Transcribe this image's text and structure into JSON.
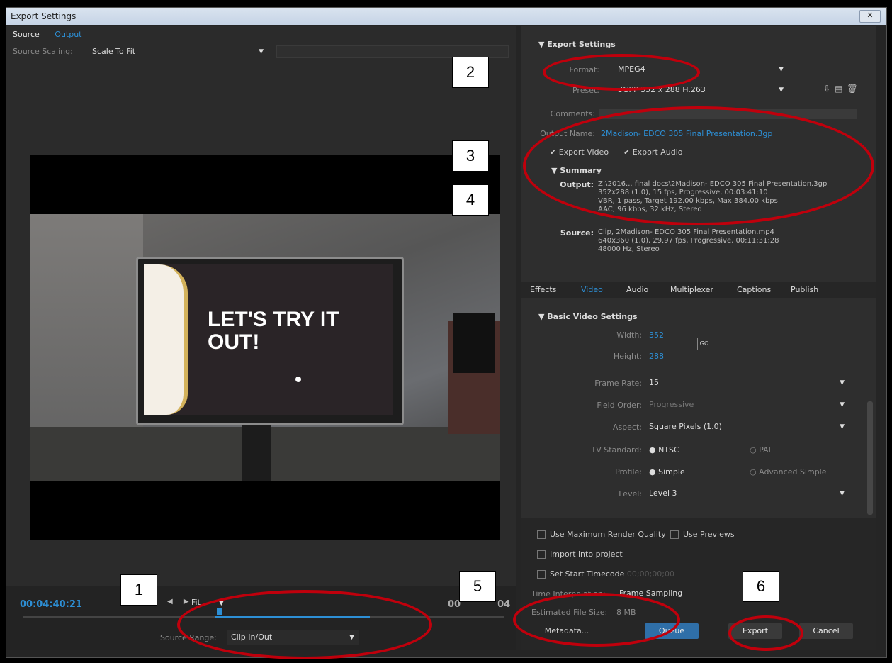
{
  "window": {
    "title": "Export Settings",
    "close_label": "✕"
  },
  "left": {
    "tabs": [
      "Source",
      "Output"
    ],
    "source_scaling_label": "Source Scaling:",
    "source_scaling_value": "Scale To Fit",
    "screen_text_line1": "LET'S TRY IT",
    "screen_text_line2": "OUT!",
    "timecode_left": "00:04:40:21",
    "timecode_right": "00",
    "timecode_right_tail": "04",
    "fit_value": "Fit",
    "source_range_label": "Source Range:",
    "source_range_value": "Clip In/Out"
  },
  "export": {
    "header": "Export Settings",
    "format_label": "Format:",
    "format_value": "MPEG4",
    "preset_label": "Preset:",
    "preset_value": "3GPP 352 x 288 H.263",
    "comments_label": "Comments:",
    "output_name_label": "Output Name:",
    "output_name_value": "2Madison- EDCO 305 Final Presentation.3gp",
    "export_video_label": "Export Video",
    "export_audio_label": "Export Audio",
    "summary_header": "Summary",
    "output_summary_label": "Output:",
    "output_summary_lines": [
      "Z:\\2016... final docs\\2Madison- EDCO 305 Final Presentation.3gp",
      "352x288 (1.0), 15 fps, Progressive, 00:03:41:10",
      "VBR, 1 pass, Target 192.00 kbps, Max 384.00 kbps",
      "AAC, 96 kbps, 32 kHz, Stereo"
    ],
    "source_summary_label": "Source:",
    "source_summary_lines": [
      "Clip, 2Madison- EDCO 305 Final Presentation.mp4",
      "640x360 (1.0), 29.97 fps, Progressive, 00:11:31:28",
      "48000 Hz, Stereo"
    ]
  },
  "fx_tabs": [
    "Effects",
    "Video",
    "Audio",
    "Multiplexer",
    "Captions",
    "Publish"
  ],
  "basic_video": {
    "header": "Basic Video Settings",
    "width_label": "Width:",
    "width_value": "352",
    "height_label": "Height:",
    "height_value": "288",
    "frame_rate_label": "Frame Rate:",
    "frame_rate_value": "15",
    "field_order_label": "Field Order:",
    "field_order_value": "Progressive",
    "aspect_label": "Aspect:",
    "aspect_value": "Square Pixels (1.0)",
    "tv_standard_label": "TV Standard:",
    "tv_ntsc": "NTSC",
    "tv_pal": "PAL",
    "profile_label": "Profile:",
    "profile_simple": "Simple",
    "profile_advanced": "Advanced Simple",
    "level_label": "Level:",
    "level_value": "Level 3"
  },
  "bottom": {
    "max_render_label": "Use Maximum Render Quality",
    "use_previews_label": "Use Previews",
    "import_project_label": "Import into project",
    "start_timecode_label": "Set Start Timecode",
    "start_timecode_value": "00;00;00;00",
    "time_interp_label": "Time Interpolation:",
    "time_interp_value": "Frame Sampling",
    "file_size_label": "Estimated File Size:",
    "file_size_value": "8 MB",
    "metadata_label": "Metadata...",
    "queue_label": "Queue",
    "export_label": "Export",
    "cancel_label": "Cancel"
  },
  "annotations": [
    "1",
    "2",
    "3",
    "4",
    "5",
    "6"
  ],
  "colors": {
    "accent": "#2d8fd5",
    "annotation": "#c0000c"
  },
  "icons": [
    "save-preset-icon",
    "import-preset-icon",
    "delete-preset-icon",
    "link-icon"
  ]
}
